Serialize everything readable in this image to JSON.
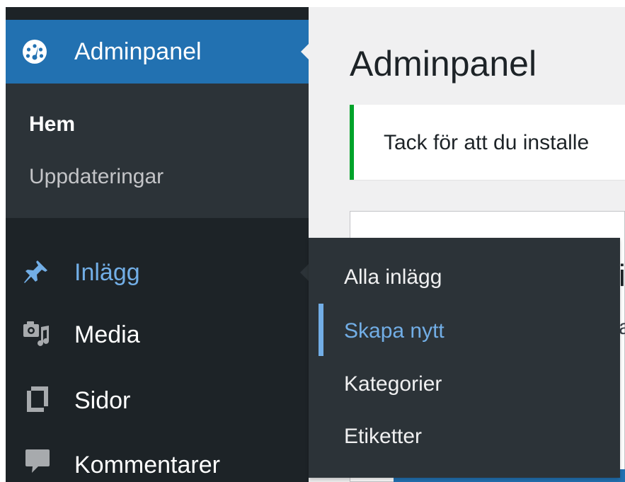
{
  "sidebar": {
    "dashboard_label": "Adminpanel",
    "home_label": "Hem",
    "updates_label": "Uppdateringar",
    "items": [
      {
        "label": "Inlägg",
        "icon": "pin-icon"
      },
      {
        "label": "Media",
        "icon": "media-icon"
      },
      {
        "label": "Sidor",
        "icon": "pages-icon"
      },
      {
        "label": "Kommentarer",
        "icon": "comments-icon"
      }
    ]
  },
  "flyout": {
    "items": [
      {
        "label": "Alla inlägg"
      },
      {
        "label": "Skapa nytt",
        "current": true
      },
      {
        "label": "Kategorier"
      },
      {
        "label": "Etiketter"
      }
    ]
  },
  "main": {
    "title": "Adminpanel",
    "notice_text": "Tack för att du installe",
    "panel_fragment_1": "i",
    "panel_fragment_2": "a"
  },
  "colors": {
    "sidebar_bg": "#1d2327",
    "submenu_bg": "#2c3338",
    "accent_blue": "#2271b1",
    "hover_blue": "#72aee6",
    "notice_green": "#00a32a",
    "content_bg": "#f0f0f1"
  }
}
